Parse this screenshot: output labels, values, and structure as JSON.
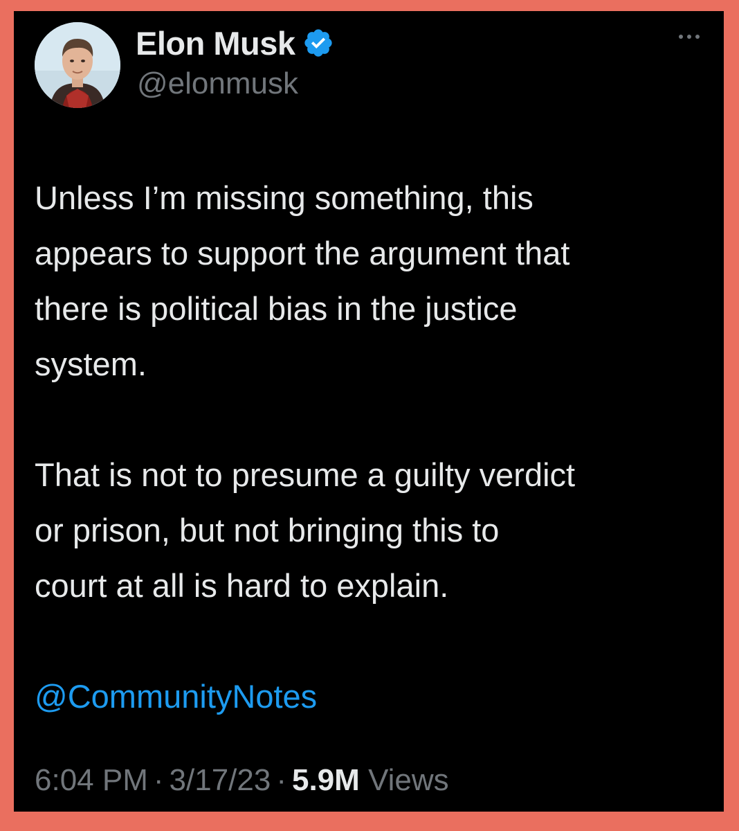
{
  "author": {
    "display_name": "Elon Musk",
    "handle": "@elonmusk",
    "verified_icon": "verified-badge-icon"
  },
  "tweet": {
    "lines_paragraph_1": [
      "Unless I’m missing something, this",
      "appears to support the argument that",
      "there is political bias in the justice",
      "system."
    ],
    "lines_paragraph_2": [
      "That is not to presume a guilty verdict",
      "or prison, but not bringing this to",
      "court at all is hard to explain."
    ],
    "mention": "@CommunityNotes"
  },
  "meta": {
    "time": "6:04 PM",
    "separator": "·",
    "date": "3/17/23",
    "views_count": "5.9M",
    "views_label": "Views"
  },
  "colors": {
    "frame_border": "#ea6f5f",
    "background": "#000000",
    "text": "#e7e9ea",
    "secondary_text": "#71767b",
    "accent": "#1d9bf0"
  }
}
